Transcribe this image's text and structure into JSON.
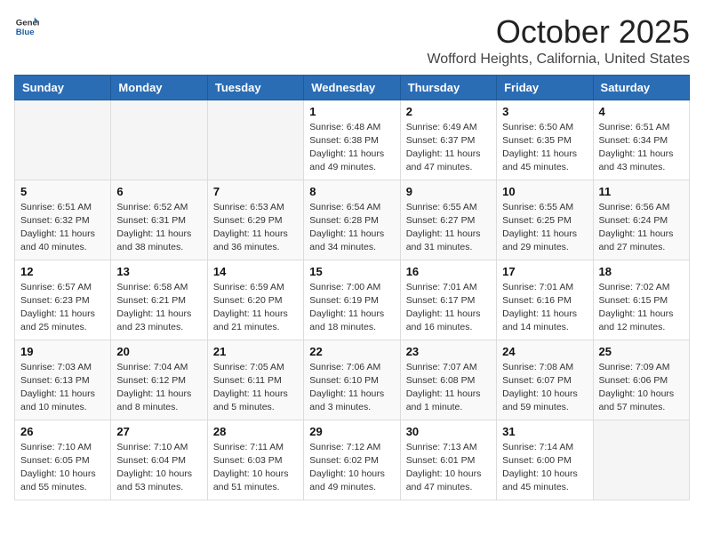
{
  "header": {
    "logo_general": "General",
    "logo_blue": "Blue",
    "month": "October 2025",
    "location": "Wofford Heights, California, United States"
  },
  "weekdays": [
    "Sunday",
    "Monday",
    "Tuesday",
    "Wednesday",
    "Thursday",
    "Friday",
    "Saturday"
  ],
  "weeks": [
    [
      {
        "day": "",
        "info": ""
      },
      {
        "day": "",
        "info": ""
      },
      {
        "day": "",
        "info": ""
      },
      {
        "day": "1",
        "info": "Sunrise: 6:48 AM\nSunset: 6:38 PM\nDaylight: 11 hours\nand 49 minutes."
      },
      {
        "day": "2",
        "info": "Sunrise: 6:49 AM\nSunset: 6:37 PM\nDaylight: 11 hours\nand 47 minutes."
      },
      {
        "day": "3",
        "info": "Sunrise: 6:50 AM\nSunset: 6:35 PM\nDaylight: 11 hours\nand 45 minutes."
      },
      {
        "day": "4",
        "info": "Sunrise: 6:51 AM\nSunset: 6:34 PM\nDaylight: 11 hours\nand 43 minutes."
      }
    ],
    [
      {
        "day": "5",
        "info": "Sunrise: 6:51 AM\nSunset: 6:32 PM\nDaylight: 11 hours\nand 40 minutes."
      },
      {
        "day": "6",
        "info": "Sunrise: 6:52 AM\nSunset: 6:31 PM\nDaylight: 11 hours\nand 38 minutes."
      },
      {
        "day": "7",
        "info": "Sunrise: 6:53 AM\nSunset: 6:29 PM\nDaylight: 11 hours\nand 36 minutes."
      },
      {
        "day": "8",
        "info": "Sunrise: 6:54 AM\nSunset: 6:28 PM\nDaylight: 11 hours\nand 34 minutes."
      },
      {
        "day": "9",
        "info": "Sunrise: 6:55 AM\nSunset: 6:27 PM\nDaylight: 11 hours\nand 31 minutes."
      },
      {
        "day": "10",
        "info": "Sunrise: 6:55 AM\nSunset: 6:25 PM\nDaylight: 11 hours\nand 29 minutes."
      },
      {
        "day": "11",
        "info": "Sunrise: 6:56 AM\nSunset: 6:24 PM\nDaylight: 11 hours\nand 27 minutes."
      }
    ],
    [
      {
        "day": "12",
        "info": "Sunrise: 6:57 AM\nSunset: 6:23 PM\nDaylight: 11 hours\nand 25 minutes."
      },
      {
        "day": "13",
        "info": "Sunrise: 6:58 AM\nSunset: 6:21 PM\nDaylight: 11 hours\nand 23 minutes."
      },
      {
        "day": "14",
        "info": "Sunrise: 6:59 AM\nSunset: 6:20 PM\nDaylight: 11 hours\nand 21 minutes."
      },
      {
        "day": "15",
        "info": "Sunrise: 7:00 AM\nSunset: 6:19 PM\nDaylight: 11 hours\nand 18 minutes."
      },
      {
        "day": "16",
        "info": "Sunrise: 7:01 AM\nSunset: 6:17 PM\nDaylight: 11 hours\nand 16 minutes."
      },
      {
        "day": "17",
        "info": "Sunrise: 7:01 AM\nSunset: 6:16 PM\nDaylight: 11 hours\nand 14 minutes."
      },
      {
        "day": "18",
        "info": "Sunrise: 7:02 AM\nSunset: 6:15 PM\nDaylight: 11 hours\nand 12 minutes."
      }
    ],
    [
      {
        "day": "19",
        "info": "Sunrise: 7:03 AM\nSunset: 6:13 PM\nDaylight: 11 hours\nand 10 minutes."
      },
      {
        "day": "20",
        "info": "Sunrise: 7:04 AM\nSunset: 6:12 PM\nDaylight: 11 hours\nand 8 minutes."
      },
      {
        "day": "21",
        "info": "Sunrise: 7:05 AM\nSunset: 6:11 PM\nDaylight: 11 hours\nand 5 minutes."
      },
      {
        "day": "22",
        "info": "Sunrise: 7:06 AM\nSunset: 6:10 PM\nDaylight: 11 hours\nand 3 minutes."
      },
      {
        "day": "23",
        "info": "Sunrise: 7:07 AM\nSunset: 6:08 PM\nDaylight: 11 hours\nand 1 minute."
      },
      {
        "day": "24",
        "info": "Sunrise: 7:08 AM\nSunset: 6:07 PM\nDaylight: 10 hours\nand 59 minutes."
      },
      {
        "day": "25",
        "info": "Sunrise: 7:09 AM\nSunset: 6:06 PM\nDaylight: 10 hours\nand 57 minutes."
      }
    ],
    [
      {
        "day": "26",
        "info": "Sunrise: 7:10 AM\nSunset: 6:05 PM\nDaylight: 10 hours\nand 55 minutes."
      },
      {
        "day": "27",
        "info": "Sunrise: 7:10 AM\nSunset: 6:04 PM\nDaylight: 10 hours\nand 53 minutes."
      },
      {
        "day": "28",
        "info": "Sunrise: 7:11 AM\nSunset: 6:03 PM\nDaylight: 10 hours\nand 51 minutes."
      },
      {
        "day": "29",
        "info": "Sunrise: 7:12 AM\nSunset: 6:02 PM\nDaylight: 10 hours\nand 49 minutes."
      },
      {
        "day": "30",
        "info": "Sunrise: 7:13 AM\nSunset: 6:01 PM\nDaylight: 10 hours\nand 47 minutes."
      },
      {
        "day": "31",
        "info": "Sunrise: 7:14 AM\nSunset: 6:00 PM\nDaylight: 10 hours\nand 45 minutes."
      },
      {
        "day": "",
        "info": ""
      }
    ]
  ]
}
